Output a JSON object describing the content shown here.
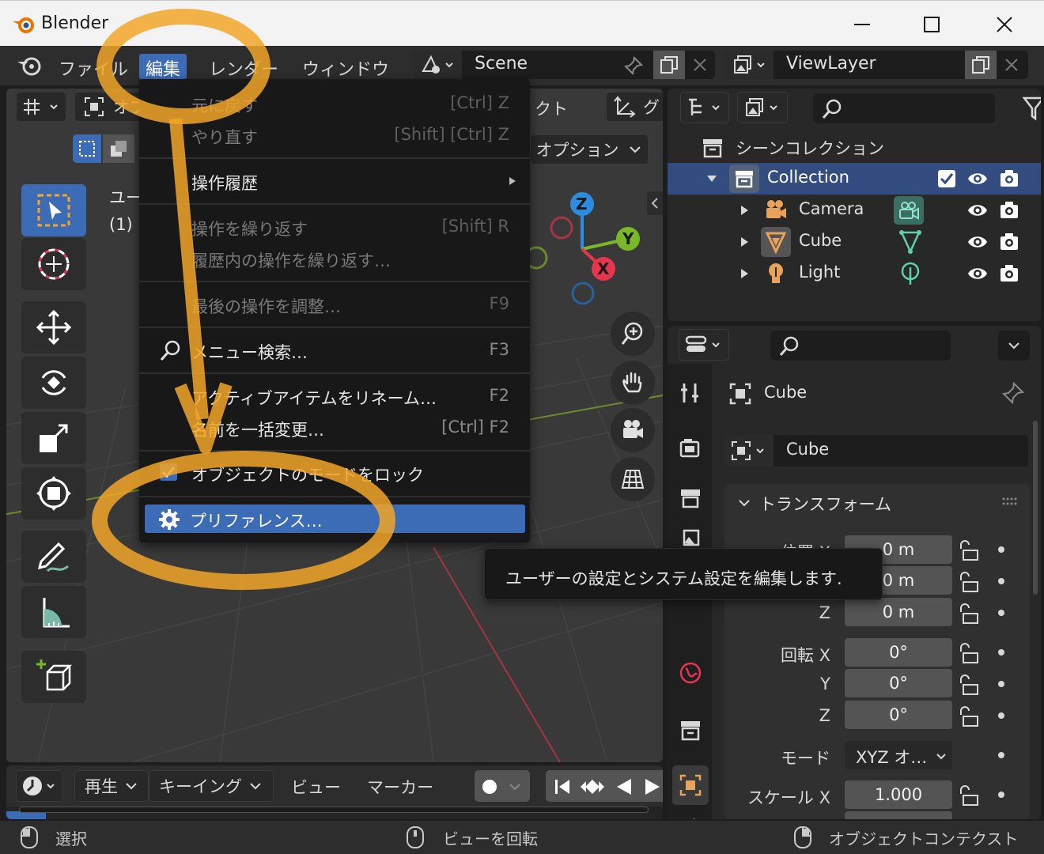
{
  "window": {
    "title": "Blender"
  },
  "menubar": {
    "items": [
      "ファイル",
      "編集",
      "レンダー",
      "ウィンドウ"
    ],
    "scene": "Scene",
    "view_layer": "ViewLayer"
  },
  "viewport": {
    "mode_short": "オブ",
    "header_fragment": "クト",
    "options": "オプション",
    "overlay_line1": "ユー",
    "overlay_line2": "(1)",
    "header_right_fragment": "グ",
    "gizmo": {
      "z": "Z",
      "y": "Y",
      "x": "X"
    }
  },
  "edit_menu": {
    "undo": {
      "label": "元に戻す",
      "shortcut": "[Ctrl] Z"
    },
    "redo": {
      "label": "やり直す",
      "shortcut": "[Shift] [Ctrl] Z"
    },
    "history": {
      "label": "操作履歴"
    },
    "repeat": {
      "label": "操作を繰り返す",
      "shortcut": "[Shift] R"
    },
    "repeat_history": {
      "label": "履歴内の操作を繰り返す…"
    },
    "adjust_last": {
      "label": "最後の操作を調整…",
      "shortcut": "F9"
    },
    "menu_search": {
      "label": "メニュー検索…",
      "shortcut": "F3"
    },
    "rename_active": {
      "label": "アクティブアイテムをリネーム…",
      "shortcut": "F2"
    },
    "batch_rename": {
      "label": "名前を一括変更…",
      "shortcut": "[Ctrl] F2"
    },
    "lock_object_modes": {
      "label": "オブジェクトのモードをロック",
      "checked": true
    },
    "preferences": {
      "label": "プリファレンス…"
    }
  },
  "tooltip": {
    "text": "ユーザーの設定とシステム設定を編集します."
  },
  "outliner": {
    "scene_collection": "シーンコレクション",
    "items": [
      {
        "name": "Collection"
      },
      {
        "name": "Camera"
      },
      {
        "name": "Cube"
      },
      {
        "name": "Light"
      }
    ]
  },
  "properties": {
    "object_name": "Cube",
    "data_name": "Cube",
    "transform_header": "トランスフォーム",
    "location_label": "位置 X",
    "y_label": "Y",
    "z_label": "Z",
    "rotation_label": "回転 X",
    "mode_label": "モード",
    "mode_value": "XYZ オ…",
    "scale_label": "スケール X",
    "location": [
      "0 m",
      "0 m",
      "0 m"
    ],
    "rotation": [
      "0°",
      "0°",
      "0°"
    ],
    "scale_x": "1.000"
  },
  "timeline": {
    "playback": "再生",
    "keying": "キーイング",
    "view": "ビュー",
    "marker": "マーカー"
  },
  "statusbar": {
    "select": "選択",
    "rotate_view": "ビューを回転",
    "object_context": "オブジェクトコンテクスト"
  },
  "colors": {
    "accent": "#3d6cb7",
    "annotation_orange": "#f2a628",
    "axis_x": "#e6354d",
    "axis_y": "#7ab82a",
    "axis_z": "#2c8ce0"
  }
}
